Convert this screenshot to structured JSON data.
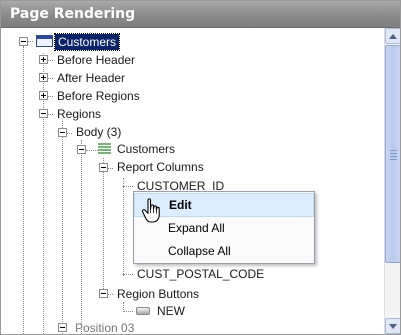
{
  "header": {
    "title": "Page Rendering"
  },
  "tree": {
    "root": "Customers",
    "before_header": "Before Header",
    "after_header": "After Header",
    "before_regions": "Before Regions",
    "regions": "Regions",
    "body": "Body (3)",
    "customers_report": "Customers",
    "report_columns": "Report Columns",
    "col_first": "CUSTOMER_ID",
    "col_last": "CUST_POSTAL_CODE",
    "region_buttons": "Region Buttons",
    "new_button": "NEW",
    "position03": "Position 03"
  },
  "context_menu": {
    "items": [
      "Edit",
      "Expand All",
      "Collapse All"
    ],
    "hovered": "Edit"
  },
  "colors": {
    "selection": "#0a246a",
    "menu_hover": "#dbeeff",
    "header": "#8a8a8a"
  },
  "icons": [
    "page-icon",
    "report-icon",
    "button-icon",
    "hand-cursor-icon"
  ]
}
